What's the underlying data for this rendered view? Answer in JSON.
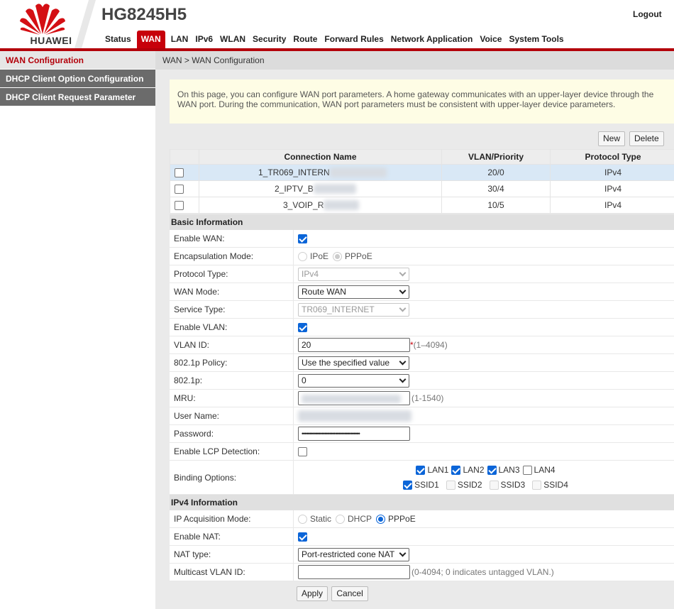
{
  "header": {
    "brand": "HUAWEI",
    "model": "HG8245H5",
    "logout": "Logout",
    "nav": [
      "Status",
      "WAN",
      "LAN",
      "IPv6",
      "WLAN",
      "Security",
      "Route",
      "Forward Rules",
      "Network Application",
      "Voice",
      "System Tools"
    ],
    "active_nav": "WAN",
    "accent_color": "#c7000b"
  },
  "sidebar": {
    "items": [
      "WAN Configuration",
      "DHCP Client Option Configuration",
      "DHCP Client Request Parameter"
    ],
    "active": "WAN Configuration"
  },
  "breadcrumb": "WAN > WAN Configuration",
  "info": "On this page, you can configure WAN port parameters. A home gateway communicates with an upper-layer device through the WAN port. During the communication, WAN port parameters must be consistent with upper-layer device parameters.",
  "table_buttons": {
    "new": "New",
    "delete": "Delete"
  },
  "connections": {
    "headers": [
      "Connection Name",
      "VLAN/Priority",
      "Protocol Type"
    ],
    "rows": [
      {
        "name": "1_TR069_INTERN",
        "vlan": "20/0",
        "protocol": "IPv4"
      },
      {
        "name": "2_IPTV_B",
        "vlan": "30/4",
        "protocol": "IPv4"
      },
      {
        "name": "3_VOIP_R",
        "vlan": "10/5",
        "protocol": "IPv4"
      }
    ]
  },
  "basic": {
    "title": "Basic Information",
    "enable_wan": {
      "label": "Enable WAN:"
    },
    "encapsulation": {
      "label": "Encapsulation Mode:",
      "options": [
        "IPoE",
        "PPPoE"
      ]
    },
    "protocol_type": {
      "label": "Protocol Type:",
      "value": "IPv4"
    },
    "wan_mode": {
      "label": "WAN Mode:",
      "value": "Route WAN"
    },
    "service_type": {
      "label": "Service Type:",
      "value": "TR069_INTERNET"
    },
    "enable_vlan": {
      "label": "Enable VLAN:"
    },
    "vlan_id": {
      "label": "VLAN ID:",
      "value": "20",
      "required": "*",
      "hint": "(1–4094)"
    },
    "policy": {
      "label": "802.1p Policy:",
      "value": "Use the specified value"
    },
    "p8021": {
      "label": "802.1p:",
      "value": "0"
    },
    "mru": {
      "label": "MRU:",
      "hint": "(1-1540)"
    },
    "username": {
      "label": "User Name:"
    },
    "password": {
      "label": "Password:",
      "value": "••••••••••••••••••••••••••••••••••••••"
    },
    "lcp": {
      "label": "Enable LCP Detection:"
    },
    "binding": {
      "label": "Binding Options:",
      "lan": [
        {
          "name": "LAN1"
        },
        {
          "name": "LAN2"
        },
        {
          "name": "LAN3"
        },
        {
          "name": "LAN4"
        }
      ],
      "ssid": [
        {
          "name": "SSID1"
        },
        {
          "name": "SSID2"
        },
        {
          "name": "SSID3"
        },
        {
          "name": "SSID4"
        }
      ]
    }
  },
  "ipv4": {
    "title": "IPv4 Information",
    "acq_mode": {
      "label": "IP Acquisition Mode:",
      "options": [
        "Static",
        "DHCP",
        "PPPoE"
      ]
    },
    "nat": {
      "label": "Enable NAT:"
    },
    "nat_type": {
      "label": "NAT type:",
      "value": "Port-restricted cone NAT"
    },
    "multicast": {
      "label": "Multicast VLAN ID:",
      "hint": "(0-4094; 0 indicates untagged VLAN.)"
    }
  },
  "actions": {
    "apply": "Apply",
    "cancel": "Cancel"
  }
}
